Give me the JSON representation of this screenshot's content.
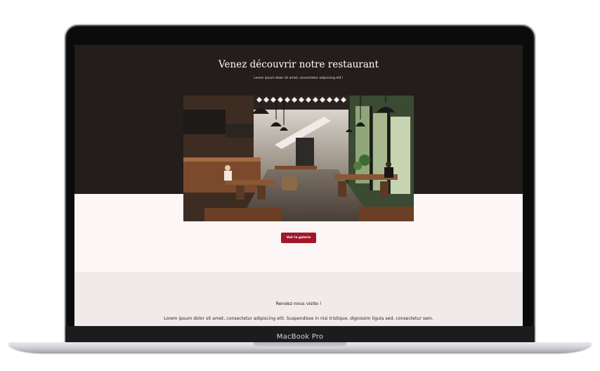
{
  "device": {
    "label": "MacBook Pro"
  },
  "website": {
    "hero": {
      "title": "Venez découvrir notre restaurant",
      "subtitle": "Lorem ipsum dolor sit amet, consectetur adipiscing elit !"
    },
    "gallery_button": {
      "label": "Voir la galerie"
    },
    "visit": {
      "title": "Rendez-nous visite !",
      "text": "Lorem ipsum dolor sit amet, consectetur adipiscing elit. Suspendisse in nisi tristique, dignissim ligula sed, consectetur sem."
    }
  },
  "colors": {
    "hero_background": "#231d1c",
    "page_background": "#fcf7f6",
    "button": "#a2172a",
    "visit_background": "#f0eaea"
  }
}
